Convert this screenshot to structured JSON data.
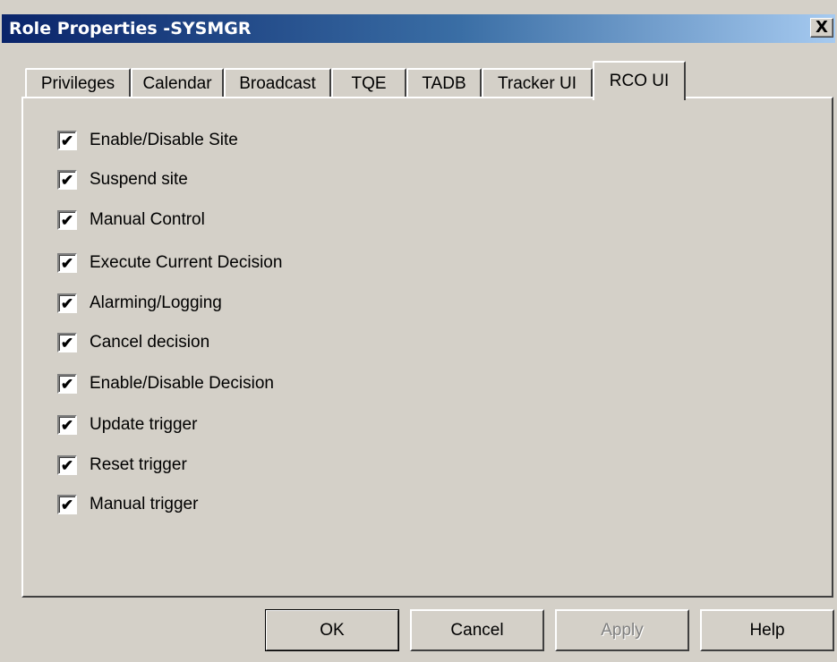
{
  "window": {
    "title": "Role Properties -SYSMGR",
    "close_glyph": "X"
  },
  "tabs": [
    {
      "label": "Privileges"
    },
    {
      "label": "Calendar"
    },
    {
      "label": "Broadcast"
    },
    {
      "label": "TQE"
    },
    {
      "label": "TADB"
    },
    {
      "label": "Tracker UI"
    },
    {
      "label": "RCO UI",
      "active": true
    }
  ],
  "permissions": [
    {
      "label": "Enable/Disable Site",
      "checked": true
    },
    {
      "label": "Suspend site",
      "checked": true
    },
    {
      "label": "Manual Control",
      "checked": true
    },
    {
      "label": "Execute Current Decision",
      "checked": true
    },
    {
      "label": "Alarming/Logging",
      "checked": true
    },
    {
      "label": "Cancel decision",
      "checked": true
    },
    {
      "label": "Enable/Disable Decision",
      "checked": true
    },
    {
      "label": "Update trigger",
      "checked": true
    },
    {
      "label": "Reset trigger",
      "checked": true
    },
    {
      "label": "Manual trigger",
      "checked": true
    }
  ],
  "check_glyph": "✔",
  "buttons": {
    "ok": "OK",
    "cancel": "Cancel",
    "apply": "Apply",
    "help": "Help"
  },
  "colors": {
    "face": "#d4d0c8",
    "title_start": "#0a246a",
    "title_end": "#a6caf0",
    "disabled_text": "#808080"
  }
}
